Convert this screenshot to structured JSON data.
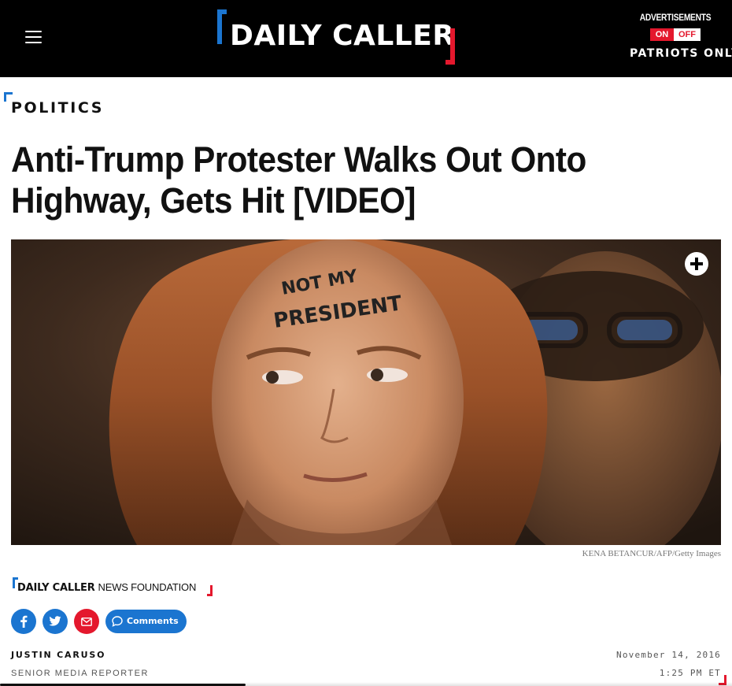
{
  "header": {
    "logo_text": "DAILY CALLER",
    "ads_label": "ADVERTISEMENTS",
    "ads_on": "ON",
    "ads_off": "OFF",
    "patriots_only": "PATRIOTS ONLY"
  },
  "article": {
    "section": "POLITICS",
    "headline": "Anti-Trump Protester Walks Out Onto Highway, Gets Hit [VIDEO]",
    "image_forehead_text_line1": "NOT MY",
    "image_forehead_text_line2": "PRESIDENT",
    "image_credit": "KENA BETANCUR/AFP/Getty Images",
    "source_bold": "DAILY CALLER",
    "source_light": "NEWS FOUNDATION",
    "comments_label": "Comments",
    "author_name": "JUSTIN CARUSO",
    "author_title": "SENIOR MEDIA REPORTER",
    "date": "November 14, 2016",
    "time": "1:25 PM ET"
  },
  "icons": {
    "menu": "hamburger-icon",
    "expand": "plus-icon",
    "facebook": "facebook-icon",
    "twitter": "twitter-icon",
    "email": "email-icon",
    "comments": "chat-bubble-icon"
  },
  "colors": {
    "header_bg": "#000000",
    "brand_blue": "#1b75d0",
    "brand_red": "#e4182d",
    "text": "#111111",
    "meta_text": "#555555"
  }
}
